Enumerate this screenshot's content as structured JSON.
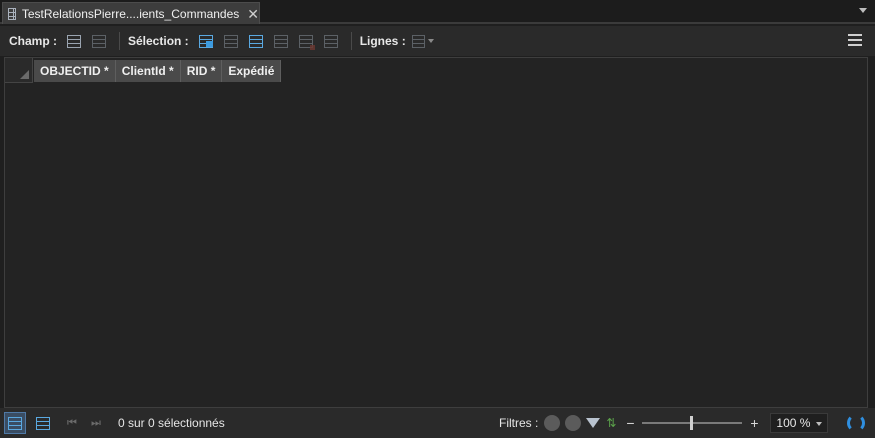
{
  "tab": {
    "title": "TestRelationsPierre....ients_Commandes",
    "icon": "table-icon",
    "close_icon": "close-icon"
  },
  "toolbar": {
    "champ_label": "Champ :",
    "selection_label": "Sélection :",
    "lignes_label": "Lignes :",
    "champ_buttons": [
      "add-field-icon",
      "calculate-field-icon"
    ],
    "selection_buttons": [
      "select-by-attributes-icon",
      "zoom-to-selection-icon",
      "switch-selection-icon",
      "clear-selection-icon",
      "delete-selection-icon",
      "copy-selection-icon"
    ],
    "lignes_buttons": [
      "rows-options-icon"
    ],
    "menu_icon": "hamburger-menu-icon"
  },
  "grid": {
    "columns": [
      "OBJECTID *",
      "ClientId *",
      "RID *",
      "Expédié"
    ],
    "rows": []
  },
  "statusbar": {
    "selection_text": "0 sur 0 sélectionnés",
    "filters_label": "Filtres :",
    "zoom_minus": "−",
    "zoom_plus": "+",
    "zoom_value": "100 %",
    "zoom_level": 0.5
  },
  "colors": {
    "accent": "#2f8fe0",
    "background": "#232323",
    "header": "#4a4a4a"
  }
}
